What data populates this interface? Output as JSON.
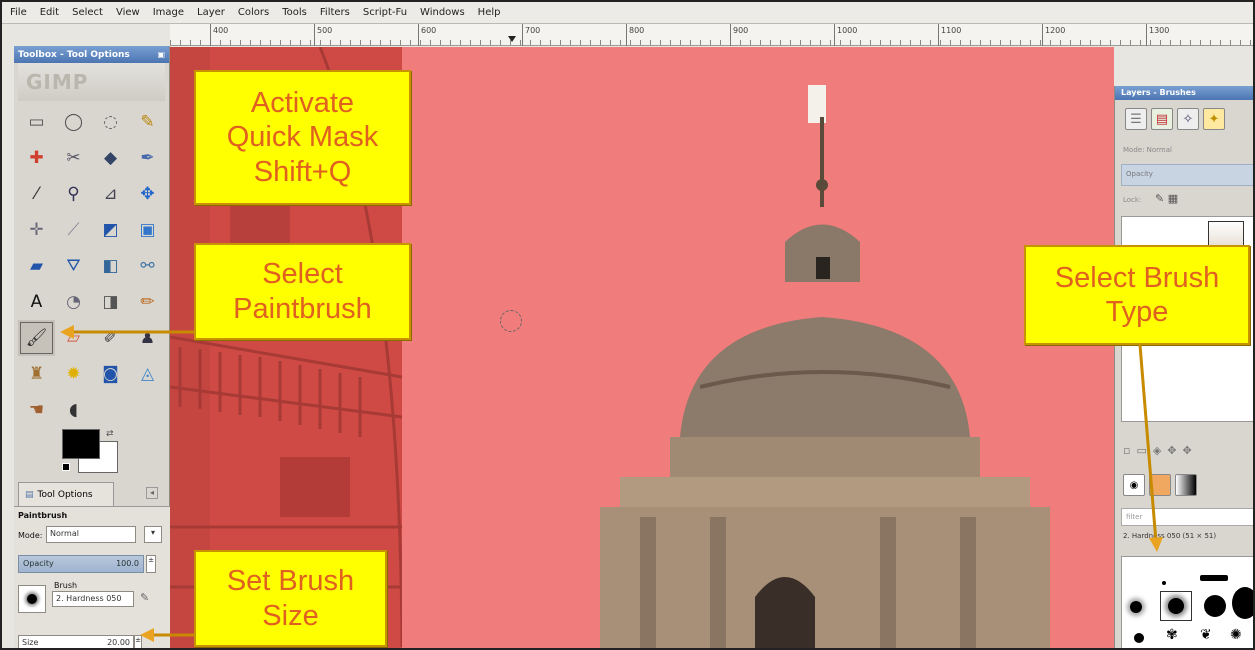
{
  "menubar": {
    "items": [
      "File",
      "Edit",
      "Select",
      "View",
      "Image",
      "Layer",
      "Colors",
      "Tools",
      "Filters",
      "Script-Fu",
      "Windows",
      "Help"
    ]
  },
  "ruler": {
    "ticks": [
      "400",
      "500",
      "600",
      "700",
      "800",
      "900",
      "1000",
      "1100",
      "1200",
      "1300"
    ]
  },
  "toolbox": {
    "title": "Toolbox - Tool Options",
    "wilber": "GIMP",
    "tools": [
      {
        "icon": "rect-select-icon",
        "glyph": "▭",
        "color": "#555"
      },
      {
        "icon": "ellipse-select-icon",
        "glyph": "◯",
        "color": "#555"
      },
      {
        "icon": "lasso-icon",
        "glyph": "◌",
        "color": "#666"
      },
      {
        "icon": "magic-wand-icon",
        "glyph": "✎",
        "color": "#b8860b"
      },
      {
        "icon": "color-select-icon",
        "glyph": "✚",
        "color": "#d04030"
      },
      {
        "icon": "scissors-icon",
        "glyph": "✂",
        "color": "#556"
      },
      {
        "icon": "foreground-select-icon",
        "glyph": "◆",
        "color": "#334466"
      },
      {
        "icon": "paths-icon",
        "glyph": "✒",
        "color": "#4466aa"
      },
      {
        "icon": "color-picker-icon",
        "glyph": "⁄",
        "color": "#333"
      },
      {
        "icon": "zoom-icon",
        "glyph": "⚲",
        "color": "#335"
      },
      {
        "icon": "measure-icon",
        "glyph": "⊿",
        "color": "#445"
      },
      {
        "icon": "move-icon",
        "glyph": "✥",
        "color": "#2266cc"
      },
      {
        "icon": "align-icon",
        "glyph": "✛",
        "color": "#667"
      },
      {
        "icon": "crop-icon",
        "glyph": "⟋",
        "color": "#889"
      },
      {
        "icon": "rotate-icon",
        "glyph": "◩",
        "color": "#2255aa"
      },
      {
        "icon": "scale-icon",
        "glyph": "▣",
        "color": "#3377cc"
      },
      {
        "icon": "shear-icon",
        "glyph": "▰",
        "color": "#2255aa"
      },
      {
        "icon": "perspective-icon",
        "glyph": "⛛",
        "color": "#2255aa"
      },
      {
        "icon": "flip-icon",
        "glyph": "◧",
        "color": "#336699"
      },
      {
        "icon": "cage-icon",
        "glyph": "⚯",
        "color": "#4477aa"
      },
      {
        "icon": "text-icon",
        "glyph": "A",
        "color": "#111"
      },
      {
        "icon": "bucket-fill-icon",
        "glyph": "◔",
        "color": "#667"
      },
      {
        "icon": "blend-icon",
        "glyph": "◨",
        "color": "#555"
      },
      {
        "icon": "pencil-icon",
        "glyph": "✏",
        "color": "#b8651b"
      },
      {
        "icon": "paintbrush-icon",
        "glyph": "🖌",
        "color": "#333",
        "active": true
      },
      {
        "icon": "eraser-icon",
        "glyph": "▱",
        "color": "#d85a40"
      },
      {
        "icon": "airbrush-icon",
        "glyph": "✐",
        "color": "#444"
      },
      {
        "icon": "ink-icon",
        "glyph": "♟",
        "color": "#334"
      },
      {
        "icon": "clone-icon",
        "glyph": "♜",
        "color": "#a07030"
      },
      {
        "icon": "heal-icon",
        "glyph": "✹",
        "color": "#e0b000"
      },
      {
        "icon": "perspective-clone-icon",
        "glyph": "◙",
        "color": "#2255aa"
      },
      {
        "icon": "blur-sharpen-icon",
        "glyph": "◬",
        "color": "#4488cc"
      },
      {
        "icon": "smudge-icon",
        "glyph": "☚",
        "color": "#a06030"
      },
      {
        "icon": "dodge-burn-icon",
        "glyph": "◖",
        "color": "#333"
      }
    ]
  },
  "tool_options": {
    "tab_label": "Tool Options",
    "title": "Paintbrush",
    "mode_label": "Mode:",
    "mode_value": "Normal",
    "opacity_label": "Opacity",
    "opacity_value": "100.0",
    "brush_label": "Brush",
    "brush_value": "2. Hardness 050",
    "size_label": "Size",
    "size_value": "20.00"
  },
  "dock": {
    "title": "Layers - Brushes",
    "mode_label": "Mode: Normal",
    "opacity_label": "Opacity",
    "lock_label": "Lock:",
    "filter_label": "filter",
    "brush_name": "2. Hardness 050 (51 × 51)"
  },
  "callouts": {
    "quick_mask": [
      "Activate",
      "Quick Mask",
      "Shift+Q"
    ],
    "paintbrush": [
      "Select",
      "Paintbrush"
    ],
    "brush_type": [
      "Select Brush",
      "Type"
    ],
    "brush_size": [
      "Set Brush",
      "Size"
    ]
  },
  "colors": {
    "mask": "#f07c7b",
    "callout_bg": "#ffff00",
    "callout_text": "#e06020",
    "callout_border": "#c79300",
    "title_bar": "#5b83bf"
  }
}
